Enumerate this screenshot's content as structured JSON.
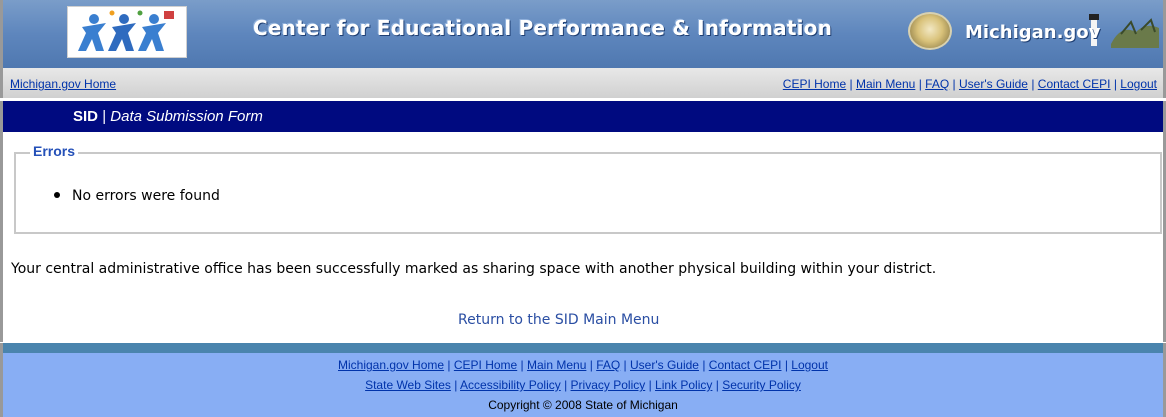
{
  "banner": {
    "title": "Center for Educational Performance & Information",
    "brand": "Michigan.gov",
    "colors": {
      "banner": "#5e86bd",
      "titlebar": "#000a80",
      "footer": "#88aef4"
    }
  },
  "nav": {
    "home": "Michigan.gov Home",
    "links": [
      "CEPI Home",
      "Main Menu",
      "FAQ",
      "User's Guide",
      "Contact CEPI",
      "Logout"
    ],
    "separator": "|"
  },
  "titlebar": {
    "app": "SID",
    "separator": "|",
    "page": "Data Submission Form"
  },
  "errors": {
    "legend": "Errors",
    "items": [
      "No errors were found"
    ]
  },
  "message": "Your central administrative office has been successfully marked as sharing space with another physical building within your district.",
  "return_link": "Return to the SID Main Menu",
  "footer": {
    "row1": [
      "Michigan.gov Home",
      "CEPI Home",
      "Main Menu",
      "FAQ",
      "User's Guide",
      "Contact CEPI",
      "Logout"
    ],
    "row2": [
      "State Web Sites",
      "Accessibility Policy",
      "Privacy Policy",
      "Link Policy",
      "Security Policy"
    ],
    "copyright": "Copyright © 2008 State of Michigan"
  },
  "icons": [
    "cepi-logo-icon",
    "michigan-seal-icon",
    "lighthouse-icon"
  ]
}
